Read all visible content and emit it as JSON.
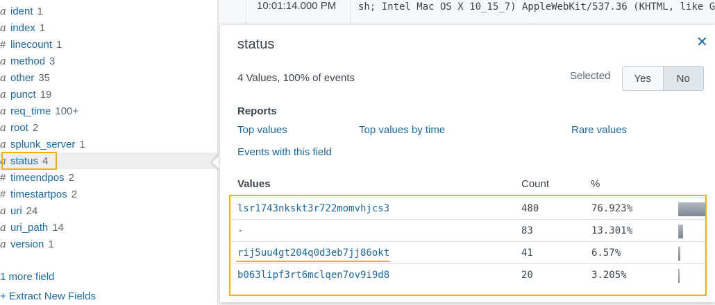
{
  "fields": [
    {
      "type": "a",
      "name": "ident",
      "count": "1"
    },
    {
      "type": "a",
      "name": "index",
      "count": "1"
    },
    {
      "type": "#",
      "name": "linecount",
      "count": "1"
    },
    {
      "type": "a",
      "name": "method",
      "count": "3"
    },
    {
      "type": "a",
      "name": "other",
      "count": "35"
    },
    {
      "type": "a",
      "name": "punct",
      "count": "19"
    },
    {
      "type": "a",
      "name": "req_time",
      "count": "100+"
    },
    {
      "type": "a",
      "name": "root",
      "count": "2"
    },
    {
      "type": "a",
      "name": "splunk_server",
      "count": "1"
    },
    {
      "type": "a",
      "name": "status",
      "count": "4"
    },
    {
      "type": "#",
      "name": "timeendpos",
      "count": "2"
    },
    {
      "type": "#",
      "name": "timestartpos",
      "count": "2"
    },
    {
      "type": "a",
      "name": "uri",
      "count": "24"
    },
    {
      "type": "a",
      "name": "uri_path",
      "count": "14"
    },
    {
      "type": "a",
      "name": "version",
      "count": "1"
    }
  ],
  "more_fields": "1 more field",
  "extract_fields": "+ Extract New Fields",
  "event": {
    "time": "10:01:14.000 PM",
    "raw": "sh; Intel Mac OS X 10_15_7) AppleWebKit/537.36 (KHTML, like G"
  },
  "popup": {
    "title": "status",
    "close_icon": "close-icon",
    "summary": "4 Values, 100% of events",
    "selected_label": "Selected",
    "yes_label": "Yes",
    "no_label": "No",
    "selected_value": "No",
    "reports_heading": "Reports",
    "reports": {
      "top_values": "Top values",
      "top_values_by_time": "Top values by time",
      "rare_values": "Rare values",
      "events_with_field": "Events with this field"
    },
    "table_headers": {
      "values": "Values",
      "count": "Count",
      "percent": "%"
    },
    "values": [
      {
        "value": "lsr1743nkskt3r722momvhjcs3",
        "count": "480",
        "percent": "76.923%",
        "fraction": 0.76923
      },
      {
        "value": "-",
        "count": "83",
        "percent": "13.301%",
        "fraction": 0.13301
      },
      {
        "value": "rij5uu4gt204q0d3eb7jj86okt",
        "count": "41",
        "percent": "6.57%",
        "fraction": 0.0657
      },
      {
        "value": "b063lipf3rt6mclqen7ov9i9d8",
        "count": "20",
        "percent": "3.205%",
        "fraction": 0.03205
      }
    ]
  },
  "colors": {
    "link": "#1a69a8",
    "highlight": "#f0b400",
    "text": "#3c444d"
  }
}
